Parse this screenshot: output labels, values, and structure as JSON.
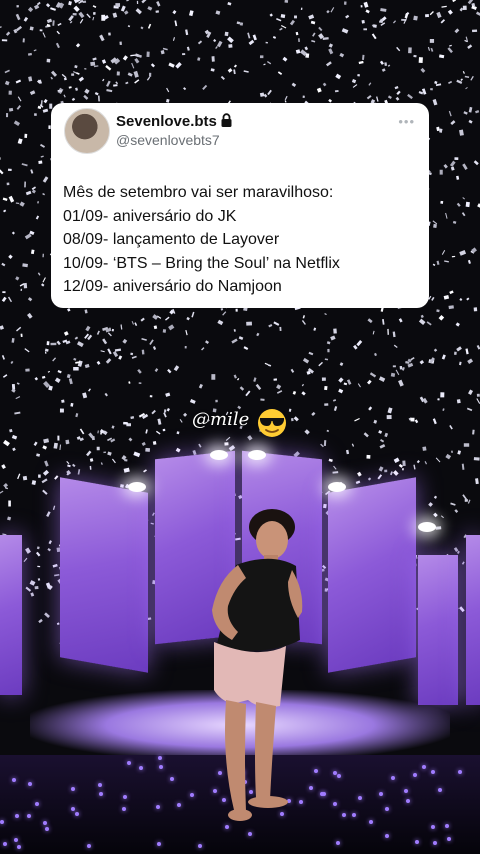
{
  "tweet": {
    "display_name": "Sevenlove.bts",
    "handle": "@sevenlovebts7",
    "lines": [
      "Mês de setembro vai ser maravilhoso:",
      "01/09- aniversário do JK",
      "08/09- lançamento de Layover",
      "10/09- ‘BTS – Bring the Soul’ na Netflix",
      "12/09- aniversário do Namjoon"
    ],
    "icons": {
      "verified": "lock-icon",
      "menu": "more-options-icon"
    }
  },
  "watermark": {
    "text": "@mile",
    "icon": "sunglasses-emoji"
  },
  "colors": {
    "stage_purple": "#8c5ad8",
    "card_bg": "#ffffff",
    "background": "#0a0a0e"
  }
}
